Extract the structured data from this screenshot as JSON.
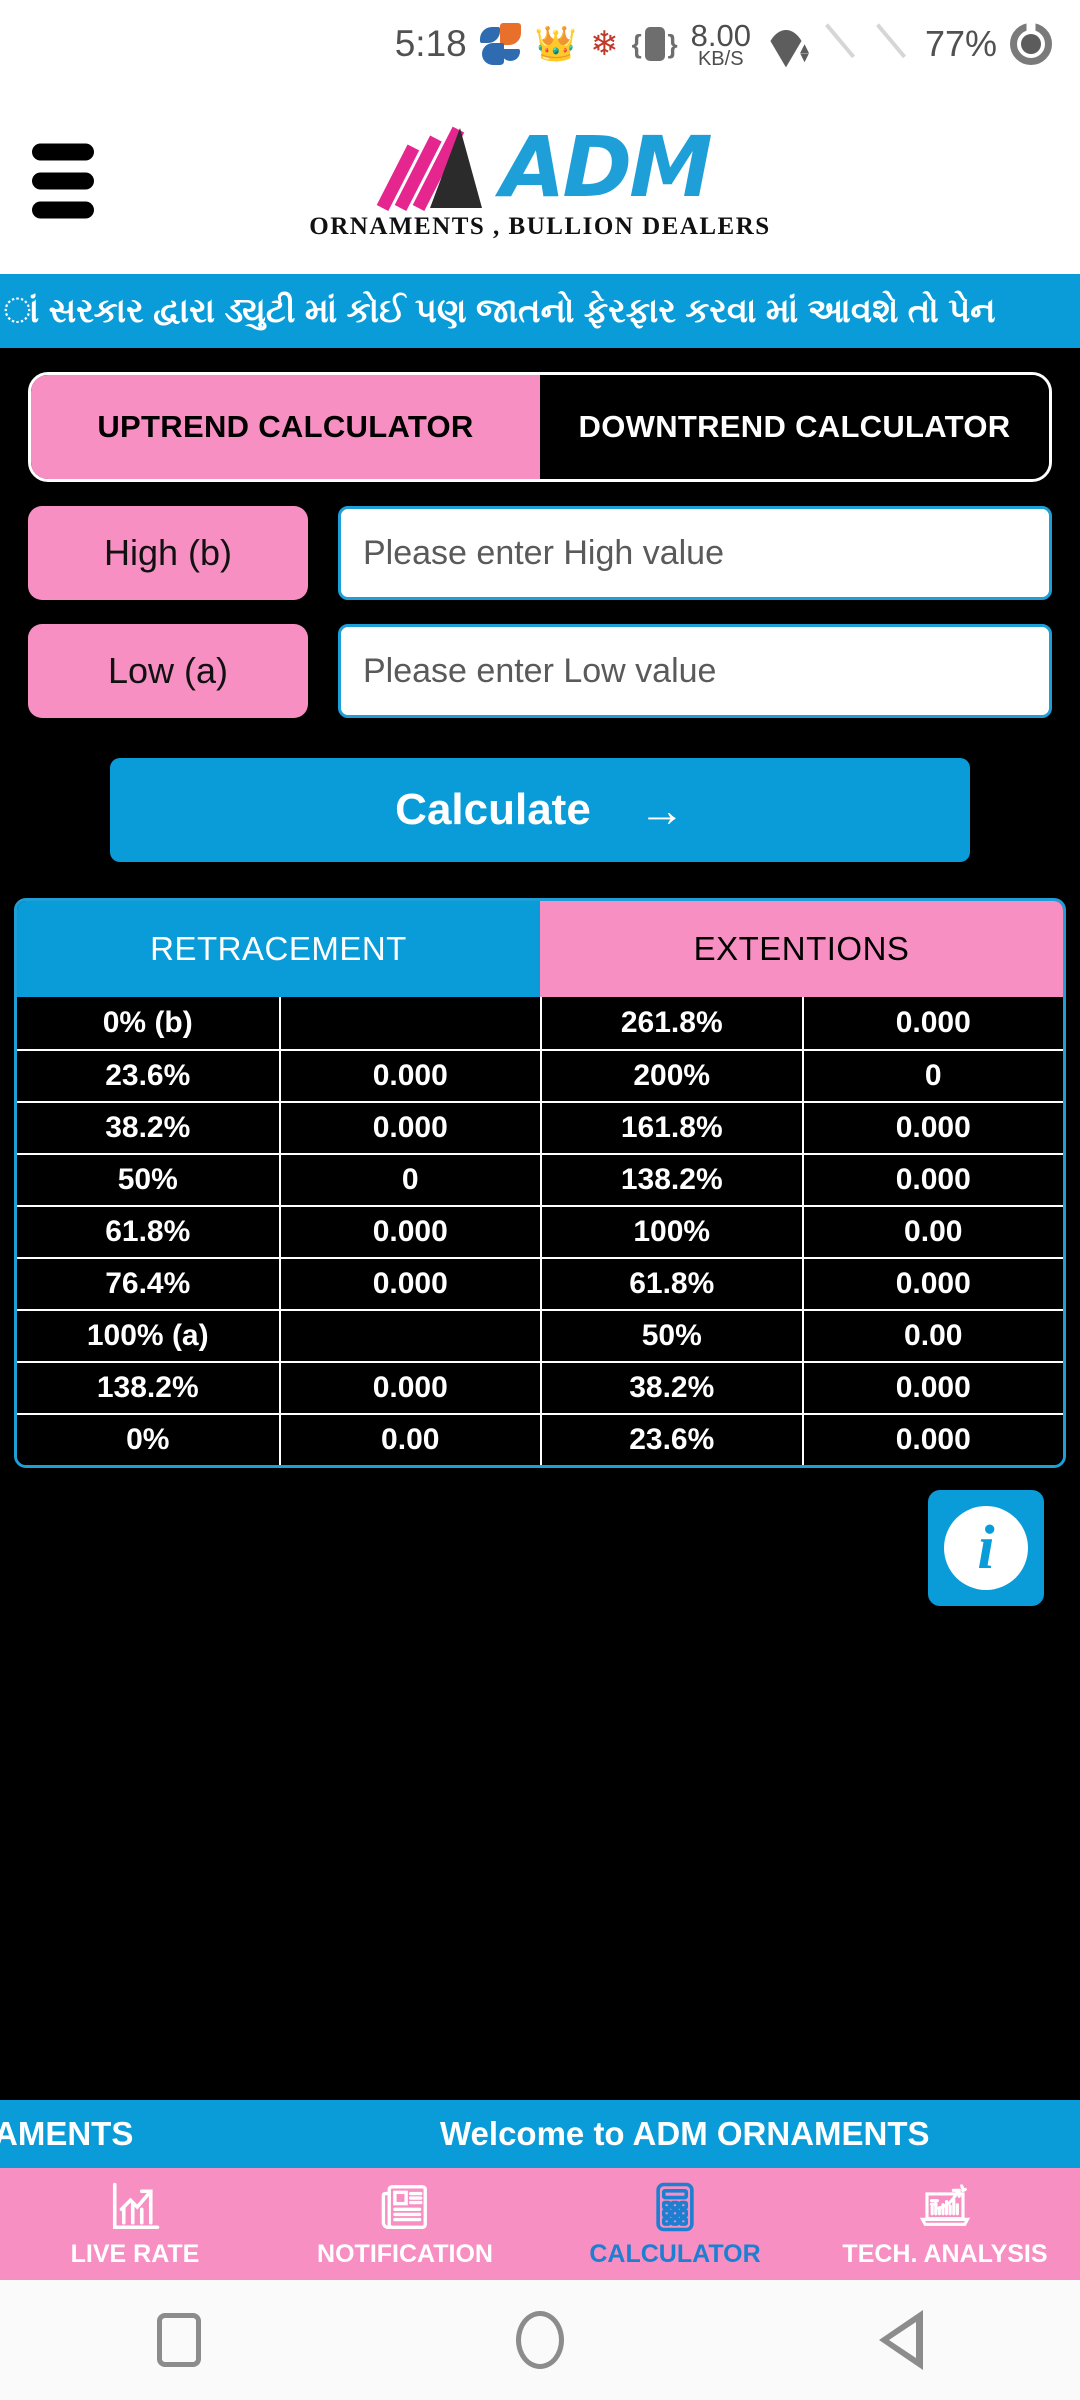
{
  "status_bar": {
    "time": "5:18",
    "net_speed_value": "8.00",
    "net_speed_unit": "KB/S",
    "battery_percent": "77%",
    "icons": [
      "sh-app-icon",
      "ganesh-icon",
      "flower-icon",
      "vibrate-icon",
      "network-speed-icon",
      "wifi-icon",
      "sim1-no-signal-icon",
      "sim2-no-signal-icon",
      "battery-icon"
    ]
  },
  "header": {
    "menu_icon": "hamburger-menu-icon",
    "brand": "ADM",
    "tagline": "ORNAMENTS , BULLION DEALERS"
  },
  "marquee_top": {
    "text": "ાં સરકાર દ્વારા ડ્યુટી માં કોઈ પણ જાતનો ફેરફાર કરવા માં આવશે તો પેન"
  },
  "tabs": {
    "uptrend": "UPTREND CALCULATOR",
    "downtrend": "DOWNTREND CALCULATOR",
    "active": "uptrend"
  },
  "form": {
    "high_label": "High (b)",
    "high_placeholder": "Please enter High value",
    "high_value": "",
    "low_label": "Low (a)",
    "low_placeholder": "Please enter Low value",
    "low_value": "",
    "calculate_label": "Calculate",
    "calculate_arrow": "→"
  },
  "table": {
    "header_retracement": "RETRACEMENT",
    "header_extentions": "EXTENTIONS",
    "rows": [
      {
        "r_pct": "0% (b)",
        "r_val": "",
        "e_pct": "261.8%",
        "e_val": "0.000"
      },
      {
        "r_pct": "23.6%",
        "r_val": "0.000",
        "e_pct": "200%",
        "e_val": "0"
      },
      {
        "r_pct": "38.2%",
        "r_val": "0.000",
        "e_pct": "161.8%",
        "e_val": "0.000"
      },
      {
        "r_pct": "50%",
        "r_val": "0",
        "e_pct": "138.2%",
        "e_val": "0.000"
      },
      {
        "r_pct": "61.8%",
        "r_val": "0.000",
        "e_pct": "100%",
        "e_val": "0.00"
      },
      {
        "r_pct": "76.4%",
        "r_val": "0.000",
        "e_pct": "61.8%",
        "e_val": "0.000"
      },
      {
        "r_pct": "100% (a)",
        "r_val": "",
        "e_pct": "50%",
        "e_val": "0.00"
      },
      {
        "r_pct": "138.2%",
        "r_val": "0.000",
        "e_pct": "38.2%",
        "e_val": "0.000"
      },
      {
        "r_pct": "0%",
        "r_val": "0.00",
        "e_pct": "23.6%",
        "e_val": "0.000"
      }
    ]
  },
  "info_button": {
    "glyph": "i",
    "icon": "info-icon"
  },
  "marquee_bottom": {
    "tail_text": "AMENTS",
    "text": "Welcome to ADM ORNAMENTS"
  },
  "bottom_nav": {
    "items": [
      {
        "label": "LIVE RATE",
        "icon": "chart-growth-icon",
        "active": false
      },
      {
        "label": "NOTIFICATION",
        "icon": "newspaper-icon",
        "active": false
      },
      {
        "label": "CALCULATOR",
        "icon": "calculator-icon",
        "active": true
      },
      {
        "label": "TECH. ANALYSIS",
        "icon": "laptop-chart-icon",
        "active": false
      }
    ]
  },
  "android_nav": {
    "recents": "recents-square-icon",
    "home": "home-circle-icon",
    "back": "back-triangle-icon"
  },
  "colors": {
    "pink": "#f78fc2",
    "blue": "#0a9cd8",
    "black": "#000000",
    "white": "#ffffff"
  }
}
